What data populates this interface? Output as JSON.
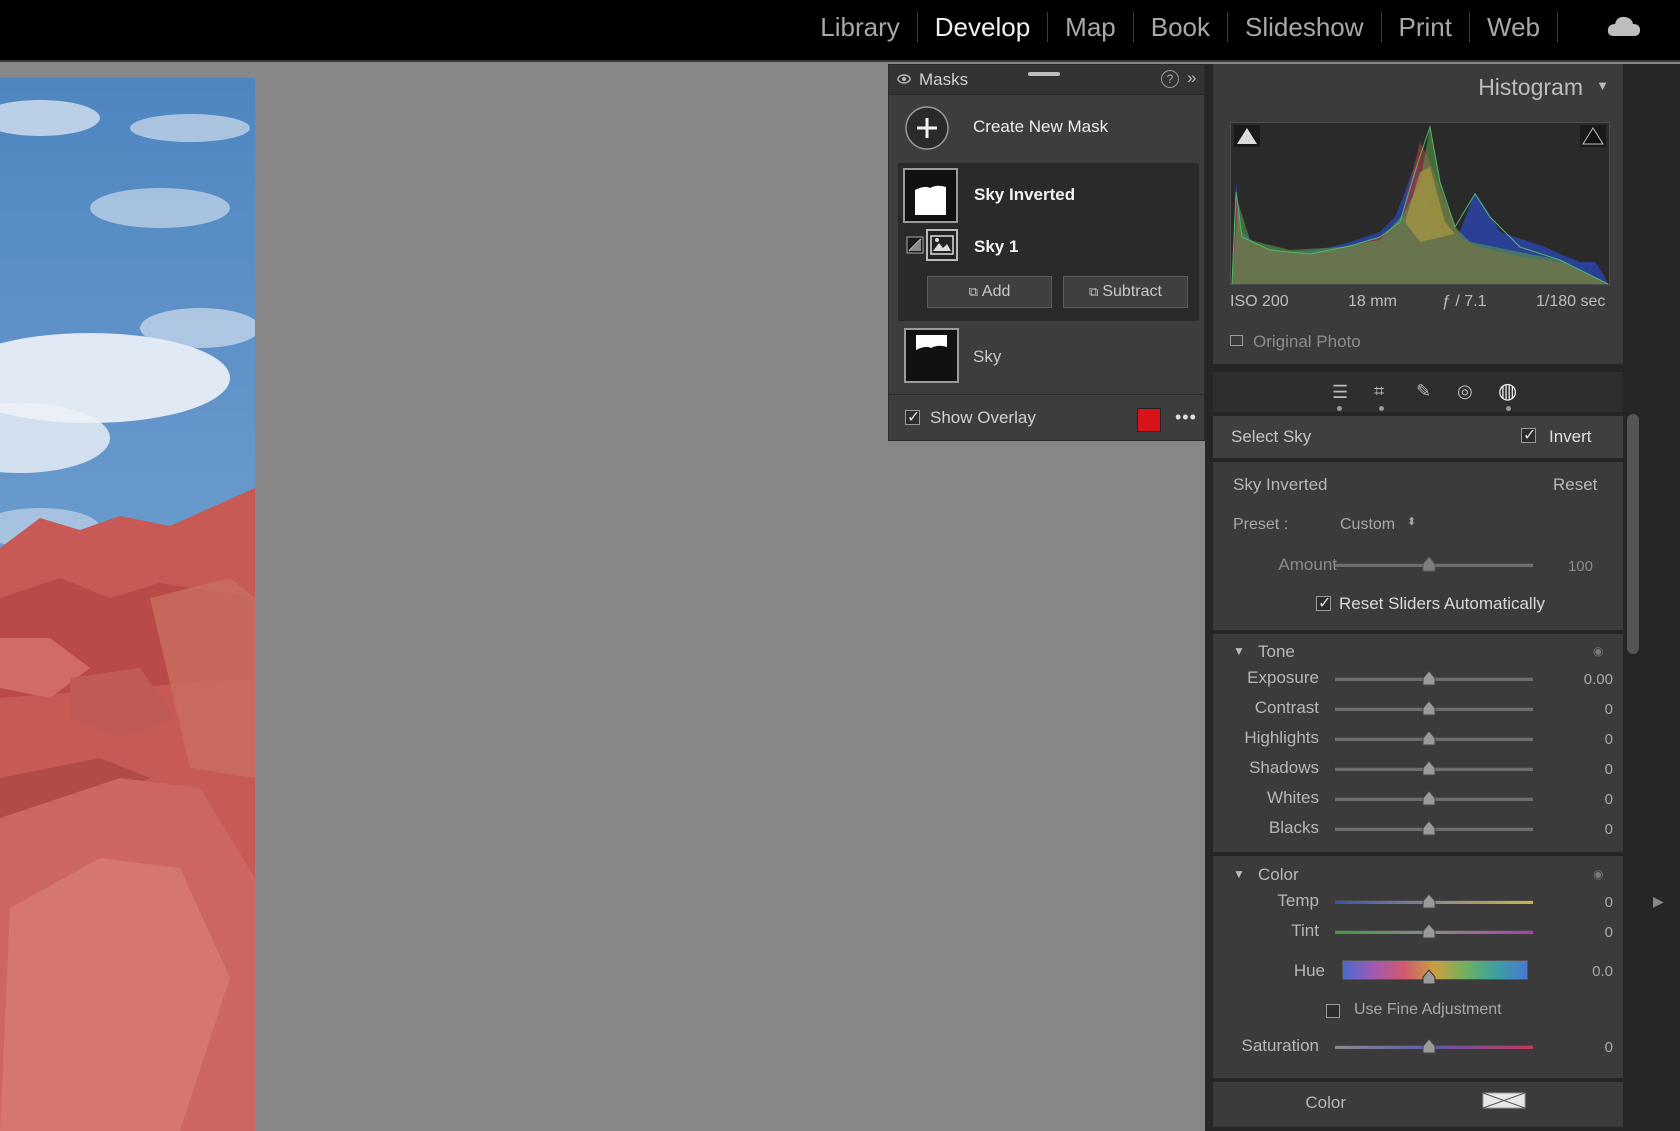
{
  "nav": {
    "modules": [
      "Library",
      "Develop",
      "Map",
      "Book",
      "Slideshow",
      "Print",
      "Web"
    ],
    "active": "Develop"
  },
  "masks_panel": {
    "title": "Masks",
    "create_label": "Create New Mask",
    "items": [
      {
        "name": "Sky Inverted"
      },
      {
        "name": "Sky 1"
      },
      {
        "name": "Sky"
      }
    ],
    "add_label": "Add",
    "subtract_label": "Subtract",
    "show_overlay_label": "Show Overlay",
    "overlay_color": "#d8141a"
  },
  "histogram": {
    "title": "Histogram",
    "iso": "ISO 200",
    "focal": "18 mm",
    "aperture": "ƒ / 7.1",
    "shutter": "1/180 sec",
    "original_label": "Original Photo"
  },
  "mask_settings": {
    "title": "Select Sky",
    "invert_label": "Invert",
    "mask_name": "Sky Inverted",
    "reset_label": "Reset",
    "preset_label": "Preset :",
    "preset_value": "Custom",
    "amount_label": "Amount",
    "amount_value": "100",
    "reset_sliders_label": "Reset Sliders Automatically"
  },
  "tone": {
    "section_label": "Tone",
    "rows": [
      {
        "label": "Exposure",
        "value": "0.00"
      },
      {
        "label": "Contrast",
        "value": "0"
      },
      {
        "label": "Highlights",
        "value": "0"
      },
      {
        "label": "Shadows",
        "value": "0"
      },
      {
        "label": "Whites",
        "value": "0"
      },
      {
        "label": "Blacks",
        "value": "0"
      }
    ]
  },
  "color": {
    "section_label": "Color",
    "temp_label": "Temp",
    "temp_value": "0",
    "tint_label": "Tint",
    "tint_value": "0",
    "hue_label": "Hue",
    "hue_value": "0.0",
    "fine_adjust_label": "Use Fine Adjustment",
    "saturation_label": "Saturation",
    "saturation_value": "0",
    "color_label": "Color"
  }
}
